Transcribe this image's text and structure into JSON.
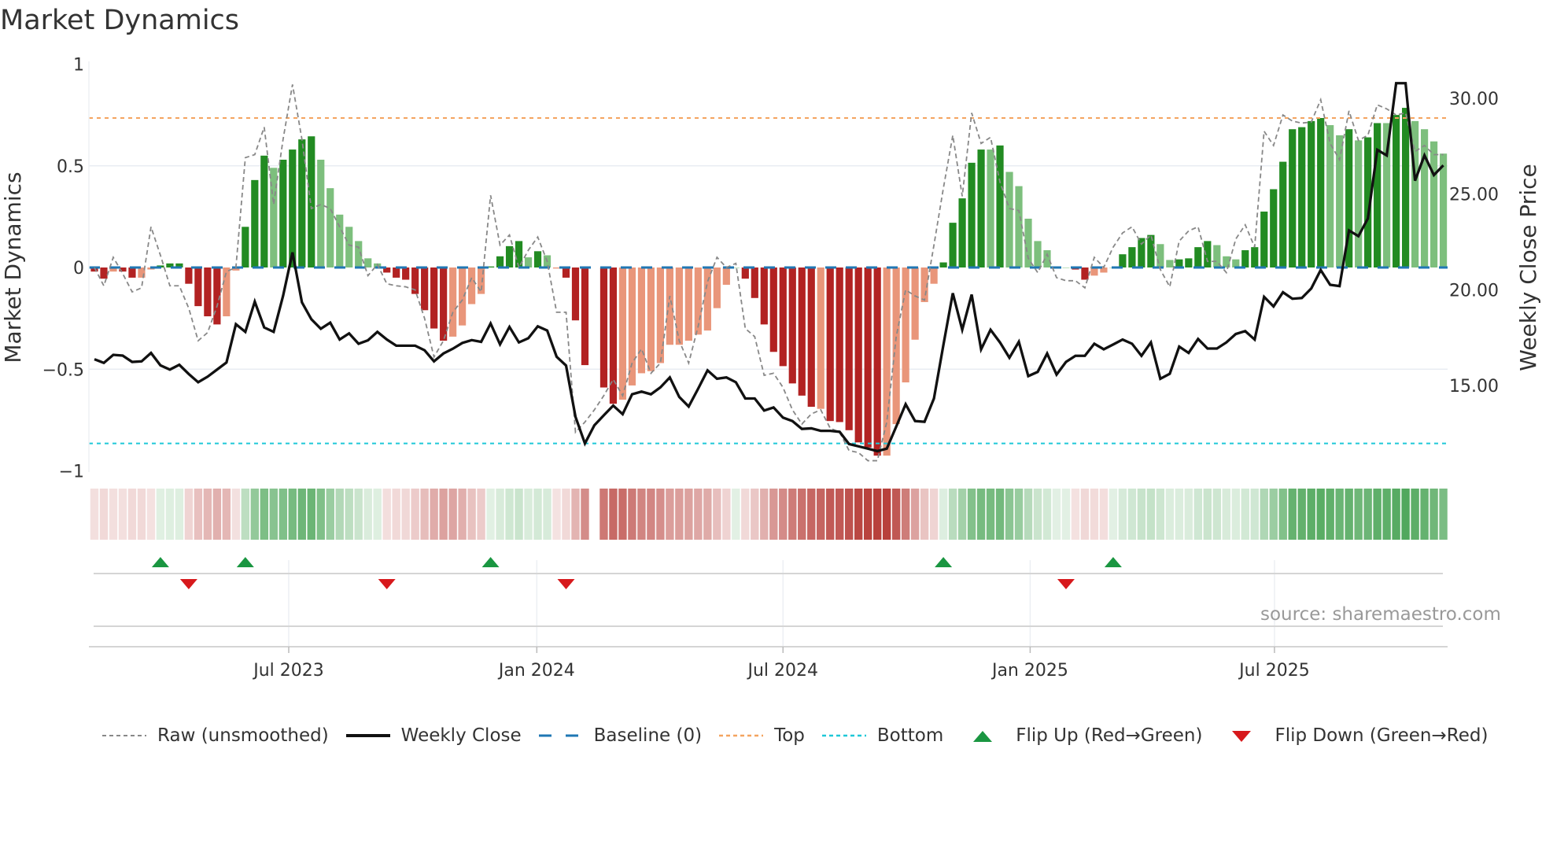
{
  "title": "Market Dynamics",
  "source": "source: sharemaestro.com",
  "colors": {
    "strong_green": "#228b22",
    "light_green": "#7dbf7d",
    "strong_red": "#b22222",
    "light_red": "#e9967a",
    "raw": "#888888",
    "close": "#111111",
    "baseline": "#1f77b4",
    "top": "#f4a460",
    "bottom": "#1fc8d8",
    "flip_up": "#1a9641",
    "flip_down": "#d7191c",
    "heat_green": "#3d9e4a",
    "heat_red": "#b8413c"
  },
  "legend": [
    {
      "label": "Raw (unsmoothed)",
      "icon": "dashed-gray-line"
    },
    {
      "label": "Weekly Close",
      "icon": "solid-black-line"
    },
    {
      "label": "Baseline (0)",
      "icon": "dashed-blue-line"
    },
    {
      "label": "Top",
      "icon": "dotted-orange-line"
    },
    {
      "label": "Bottom",
      "icon": "dotted-cyan-line"
    },
    {
      "label": "Flip Up (Red→Green)",
      "icon": "triangle-up"
    },
    {
      "label": "Flip Down (Green→Red)",
      "icon": "triangle-down"
    }
  ],
  "chart_data": {
    "type": "bar",
    "title": "Market Dynamics",
    "ylabel": "Market Dynamics",
    "y2label": "Weekly Close Price",
    "ylim": [
      -1,
      1
    ],
    "y2lim": [
      9.0,
      33.4
    ],
    "yticks": [
      {
        "v": 1,
        "label": "1"
      },
      {
        "v": 0.5,
        "label": "0.5"
      },
      {
        "v": 0,
        "label": "0"
      },
      {
        "v": -0.5,
        "label": "−0.5"
      },
      {
        "v": -1,
        "label": "−1"
      }
    ],
    "y2ticks": [
      {
        "v": 30,
        "label": "30.00"
      },
      {
        "v": 25,
        "label": "25.00"
      },
      {
        "v": 20,
        "label": "20.00"
      },
      {
        "v": 15,
        "label": "15.00"
      }
    ],
    "x_unit": "week index",
    "xticks": [
      {
        "week": 20.6,
        "label": "Jul 2023"
      },
      {
        "week": 46.9,
        "label": "Jan 2024"
      },
      {
        "week": 73.0,
        "label": "Jul 2024"
      },
      {
        "week": 99.2,
        "label": "Jan 2025"
      },
      {
        "week": 125.1,
        "label": "Jul 2025"
      }
    ],
    "top_level": 0.735,
    "bottom_level": -0.865,
    "baseline": 0,
    "momentum": [
      -0.02,
      -0.055,
      -0.02,
      -0.02,
      -0.05,
      -0.05,
      -0.01,
      0.01,
      0.02,
      0.02,
      -0.08,
      -0.19,
      -0.24,
      -0.28,
      -0.24,
      -0.015,
      0.2,
      0.43,
      0.55,
      0.49,
      0.53,
      0.58,
      0.63,
      0.645,
      0.53,
      0.39,
      0.26,
      0.2,
      0.13,
      0.045,
      0.02,
      -0.025,
      -0.05,
      -0.06,
      -0.13,
      -0.21,
      -0.3,
      -0.36,
      -0.34,
      -0.285,
      -0.18,
      -0.13,
      0.005,
      0.055,
      0.105,
      0.13,
      0.05,
      0.08,
      0.06,
      -0.005,
      -0.05,
      -0.26,
      -0.48,
      null,
      -0.59,
      -0.67,
      -0.65,
      -0.58,
      -0.52,
      -0.51,
      -0.47,
      -0.38,
      -0.38,
      -0.36,
      -0.33,
      -0.31,
      -0.2,
      -0.085,
      0,
      -0.055,
      -0.15,
      -0.28,
      -0.415,
      -0.485,
      -0.57,
      -0.63,
      -0.685,
      -0.695,
      -0.755,
      -0.76,
      -0.8,
      -0.86,
      -0.885,
      -0.925,
      -0.925,
      -0.77,
      -0.565,
      -0.355,
      -0.17,
      -0.08,
      0.025,
      0.22,
      0.34,
      0.515,
      0.58,
      0.58,
      0.6,
      0.47,
      0.4,
      0.24,
      0.13,
      0.085,
      0,
      0,
      -0.01,
      -0.06,
      -0.04,
      -0.025,
      0,
      0.065,
      0.1,
      0.145,
      0.16,
      0.115,
      0.037,
      0.04,
      0.045,
      0.1,
      0.13,
      0.11,
      0.055,
      0.04,
      0.085,
      0.1,
      0.275,
      0.385,
      0.52,
      0.68,
      0.69,
      0.72,
      0.735,
      0.7,
      0.65,
      0.68,
      0.625,
      0.64,
      0.71,
      0.71,
      0.75,
      0.785,
      0.72,
      0.68,
      0.62,
      0.56
    ],
    "strong": [
      1,
      1,
      0,
      1,
      1,
      0,
      0,
      1,
      1,
      1,
      1,
      1,
      1,
      1,
      0,
      0,
      1,
      1,
      1,
      0,
      1,
      1,
      1,
      1,
      0,
      0,
      0,
      0,
      0,
      0,
      0,
      1,
      1,
      1,
      1,
      1,
      1,
      1,
      0,
      0,
      0,
      0,
      1,
      1,
      1,
      1,
      0,
      1,
      0,
      0,
      1,
      1,
      1,
      0,
      1,
      1,
      0,
      0,
      0,
      0,
      0,
      0,
      0,
      0,
      0,
      0,
      0,
      0,
      0,
      1,
      1,
      1,
      1,
      1,
      1,
      1,
      1,
      0,
      1,
      1,
      1,
      1,
      1,
      1,
      0,
      0,
      0,
      0,
      0,
      0,
      1,
      1,
      1,
      1,
      1,
      0,
      1,
      0,
      0,
      0,
      0,
      0,
      0,
      0,
      1,
      1,
      0,
      0,
      0,
      1,
      1,
      1,
      1,
      0,
      0,
      1,
      1,
      1,
      1,
      0,
      0,
      0,
      1,
      1,
      1,
      1,
      1,
      1,
      1,
      1,
      1,
      0,
      0,
      1,
      0,
      1,
      1,
      0,
      1,
      1,
      0,
      0,
      0,
      0
    ],
    "raw": [
      0,
      -0.09,
      0.05,
      -0.03,
      -0.12,
      -0.1,
      0.2,
      0.06,
      -0.09,
      -0.09,
      -0.2,
      -0.36,
      -0.32,
      -0.19,
      -0.02,
      0,
      0.54,
      0.555,
      0.69,
      0.31,
      0.63,
      0.9,
      0.63,
      0.29,
      0.31,
      0.29,
      0.2,
      0.11,
      0.1,
      -0.04,
      0.015,
      -0.08,
      -0.09,
      -0.095,
      -0.11,
      -0.25,
      -0.44,
      -0.36,
      -0.22,
      -0.16,
      -0.05,
      -0.12,
      0.355,
      0.11,
      0.16,
      0,
      0.085,
      0.15,
      0.03,
      -0.22,
      -0.22,
      -0.81,
      -0.76,
      -0.7,
      -0.63,
      -0.55,
      -0.63,
      -0.47,
      -0.4,
      -0.52,
      -0.47,
      -0.14,
      -0.36,
      -0.47,
      -0.29,
      -0.07,
      0.05,
      0,
      0.02,
      -0.3,
      -0.34,
      -0.53,
      -0.52,
      -0.59,
      -0.7,
      -0.77,
      -0.72,
      -0.7,
      -0.79,
      -0.81,
      -0.9,
      -0.91,
      -0.95,
      -0.95,
      -0.76,
      -0.34,
      -0.11,
      -0.14,
      -0.16,
      0.11,
      0.39,
      0.65,
      0.35,
      0.76,
      0.61,
      0.64,
      0.42,
      0.29,
      0.28,
      0.045,
      -0.025,
      0.065,
      -0.05,
      -0.065,
      -0.065,
      -0.1,
      0.05,
      0,
      0.1,
      0.17,
      0.2,
      0.115,
      0.16,
      -0.01,
      -0.095,
      0.13,
      0.18,
      0.2,
      0.03,
      0.03,
      -0.025,
      0.14,
      0.21,
      0.1,
      0.67,
      0.6,
      0.75,
      0.72,
      0.71,
      0.715,
      0.825,
      0.61,
      0.53,
      0.77,
      0.625,
      0.65,
      0.8,
      0.78,
      0.75,
      0.76,
      0.57,
      0.6,
      0.555,
      0.555
    ],
    "weekly_close": [
      16.37,
      16.18,
      16.6,
      16.56,
      16.23,
      16.26,
      16.7,
      16.05,
      15.83,
      16.08,
      15.6,
      15.17,
      15.46,
      15.83,
      16.2,
      18.2,
      17.8,
      19.38,
      18.03,
      17.8,
      19.68,
      21.95,
      19.34,
      18.46,
      17.96,
      18.28,
      17.4,
      17.72,
      17.18,
      17.36,
      17.8,
      17.4,
      17.08,
      17.08,
      17.08,
      16.84,
      16.26,
      16.67,
      16.92,
      17.22,
      17.37,
      17.28,
      18.24,
      17.15,
      18.06,
      17.25,
      17.47,
      18.09,
      17.87,
      16.5,
      16.04,
      13.36,
      11.97,
      12.92,
      13.44,
      13.95,
      13.5,
      14.54,
      14.68,
      14.54,
      14.9,
      15.42,
      14.4,
      13.9,
      14.83,
      15.79,
      15.35,
      15.42,
      15.17,
      14.32,
      14.32,
      13.69,
      13.85,
      13.32,
      13.14,
      12.73,
      12.76,
      12.63,
      12.63,
      12.58,
      11.94,
      11.82,
      11.7,
      11.57,
      11.7,
      12.85,
      14.02,
      13.14,
      13.1,
      14.32,
      17.11,
      19.82,
      17.91,
      19.75,
      16.89,
      17.91,
      17.25,
      16.45,
      17.28,
      15.49,
      15.71,
      16.67,
      15.57,
      16.23,
      16.55,
      16.55,
      17.18,
      16.89,
      17.14,
      17.4,
      17.18,
      16.55,
      17.25,
      15.35,
      15.61,
      17.03,
      16.7,
      17.43,
      16.93,
      16.93,
      17.25,
      17.69,
      17.84,
      17.4,
      19.63,
      19.13,
      19.87,
      19.53,
      19.57,
      20.07,
      21.03,
      20.26,
      20.19,
      23.1,
      22.8,
      23.72,
      27.31,
      27.02,
      30.79,
      30.79,
      25.7,
      27.02,
      25.99,
      26.5
    ],
    "flip_up_weeks": [
      7,
      16,
      42,
      90,
      108
    ],
    "flip_down_weeks": [
      10,
      31,
      50,
      103
    ],
    "grid": true,
    "legend_position": "bottom"
  }
}
